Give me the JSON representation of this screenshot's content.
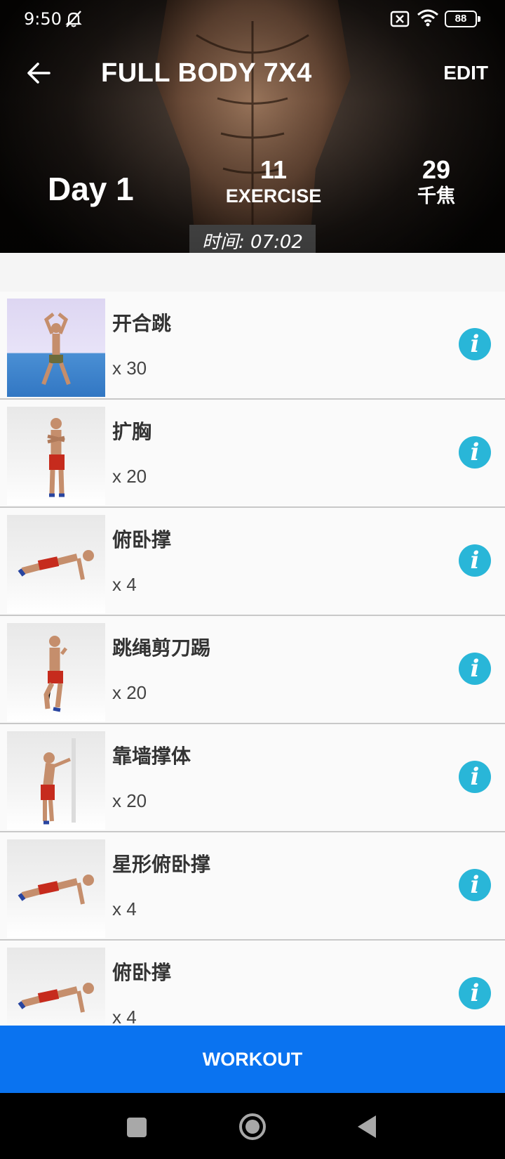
{
  "status_bar": {
    "time": "9:50",
    "battery": "88",
    "icons": [
      "bell-muted-icon",
      "sim-x-icon",
      "wifi-icon",
      "battery-icon"
    ]
  },
  "header": {
    "title": "FULL BODY 7X4",
    "edit_label": "EDIT",
    "back_icon": "arrow-left-icon"
  },
  "summary": {
    "day": "Day 1",
    "exercise_count": "11",
    "exercise_label": "EXERCISE",
    "calories": "29",
    "calories_unit": "千焦",
    "duration": "时间: 07:02"
  },
  "exercises": [
    {
      "name": "开合跳",
      "reps": "x 30",
      "thumb": "jump"
    },
    {
      "name": "扩胸",
      "reps": "x 20",
      "thumb": "stand"
    },
    {
      "name": "俯卧撑",
      "reps": "x 4",
      "thumb": "pushup"
    },
    {
      "name": "跳绳剪刀踢",
      "reps": "x 20",
      "thumb": "walk"
    },
    {
      "name": "靠墙撑体",
      "reps": "x 20",
      "thumb": "wall"
    },
    {
      "name": "星形俯卧撑",
      "reps": "x 4",
      "thumb": "pushup"
    },
    {
      "name": "俯卧撑",
      "reps": "x 4",
      "thumb": "pushup"
    }
  ],
  "workout_button": "WORKOUT",
  "colors": {
    "accent_blue": "#0a73f0",
    "info_cyan": "#29b6d8"
  }
}
